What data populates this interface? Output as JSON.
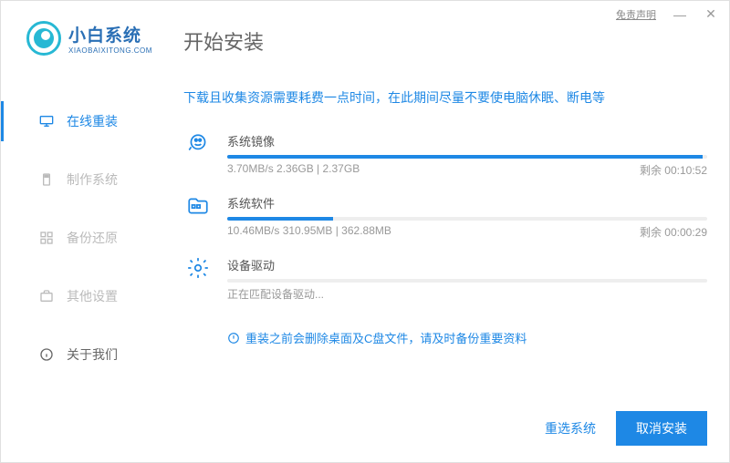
{
  "titlebar": {
    "disclaimer": "免责声明"
  },
  "logo": {
    "cn": "小白系统",
    "en": "XIAOBAIXITONG.COM"
  },
  "sidebar": {
    "items": [
      {
        "label": "在线重装"
      },
      {
        "label": "制作系统"
      },
      {
        "label": "备份还原"
      },
      {
        "label": "其他设置"
      },
      {
        "label": "关于我们"
      }
    ]
  },
  "page": {
    "title": "开始安装",
    "notice": "下载且收集资源需要耗费一点时间，在此期间尽量不要使电脑休眠、断电等"
  },
  "tasks": [
    {
      "name": "系统镜像",
      "left": "3.70MB/s 2.36GB | 2.37GB",
      "right": "剩余 00:10:52",
      "progress": 99
    },
    {
      "name": "系统软件",
      "left": "10.46MB/s 310.95MB | 362.88MB",
      "right": "剩余 00:00:29",
      "progress": 22
    },
    {
      "name": "设备驱动",
      "status": "正在匹配设备驱动...",
      "progress": 0
    }
  ],
  "warning": "重装之前会删除桌面及C盘文件，请及时备份重要资料",
  "footer": {
    "reselect": "重选系统",
    "cancel": "取消安装"
  }
}
